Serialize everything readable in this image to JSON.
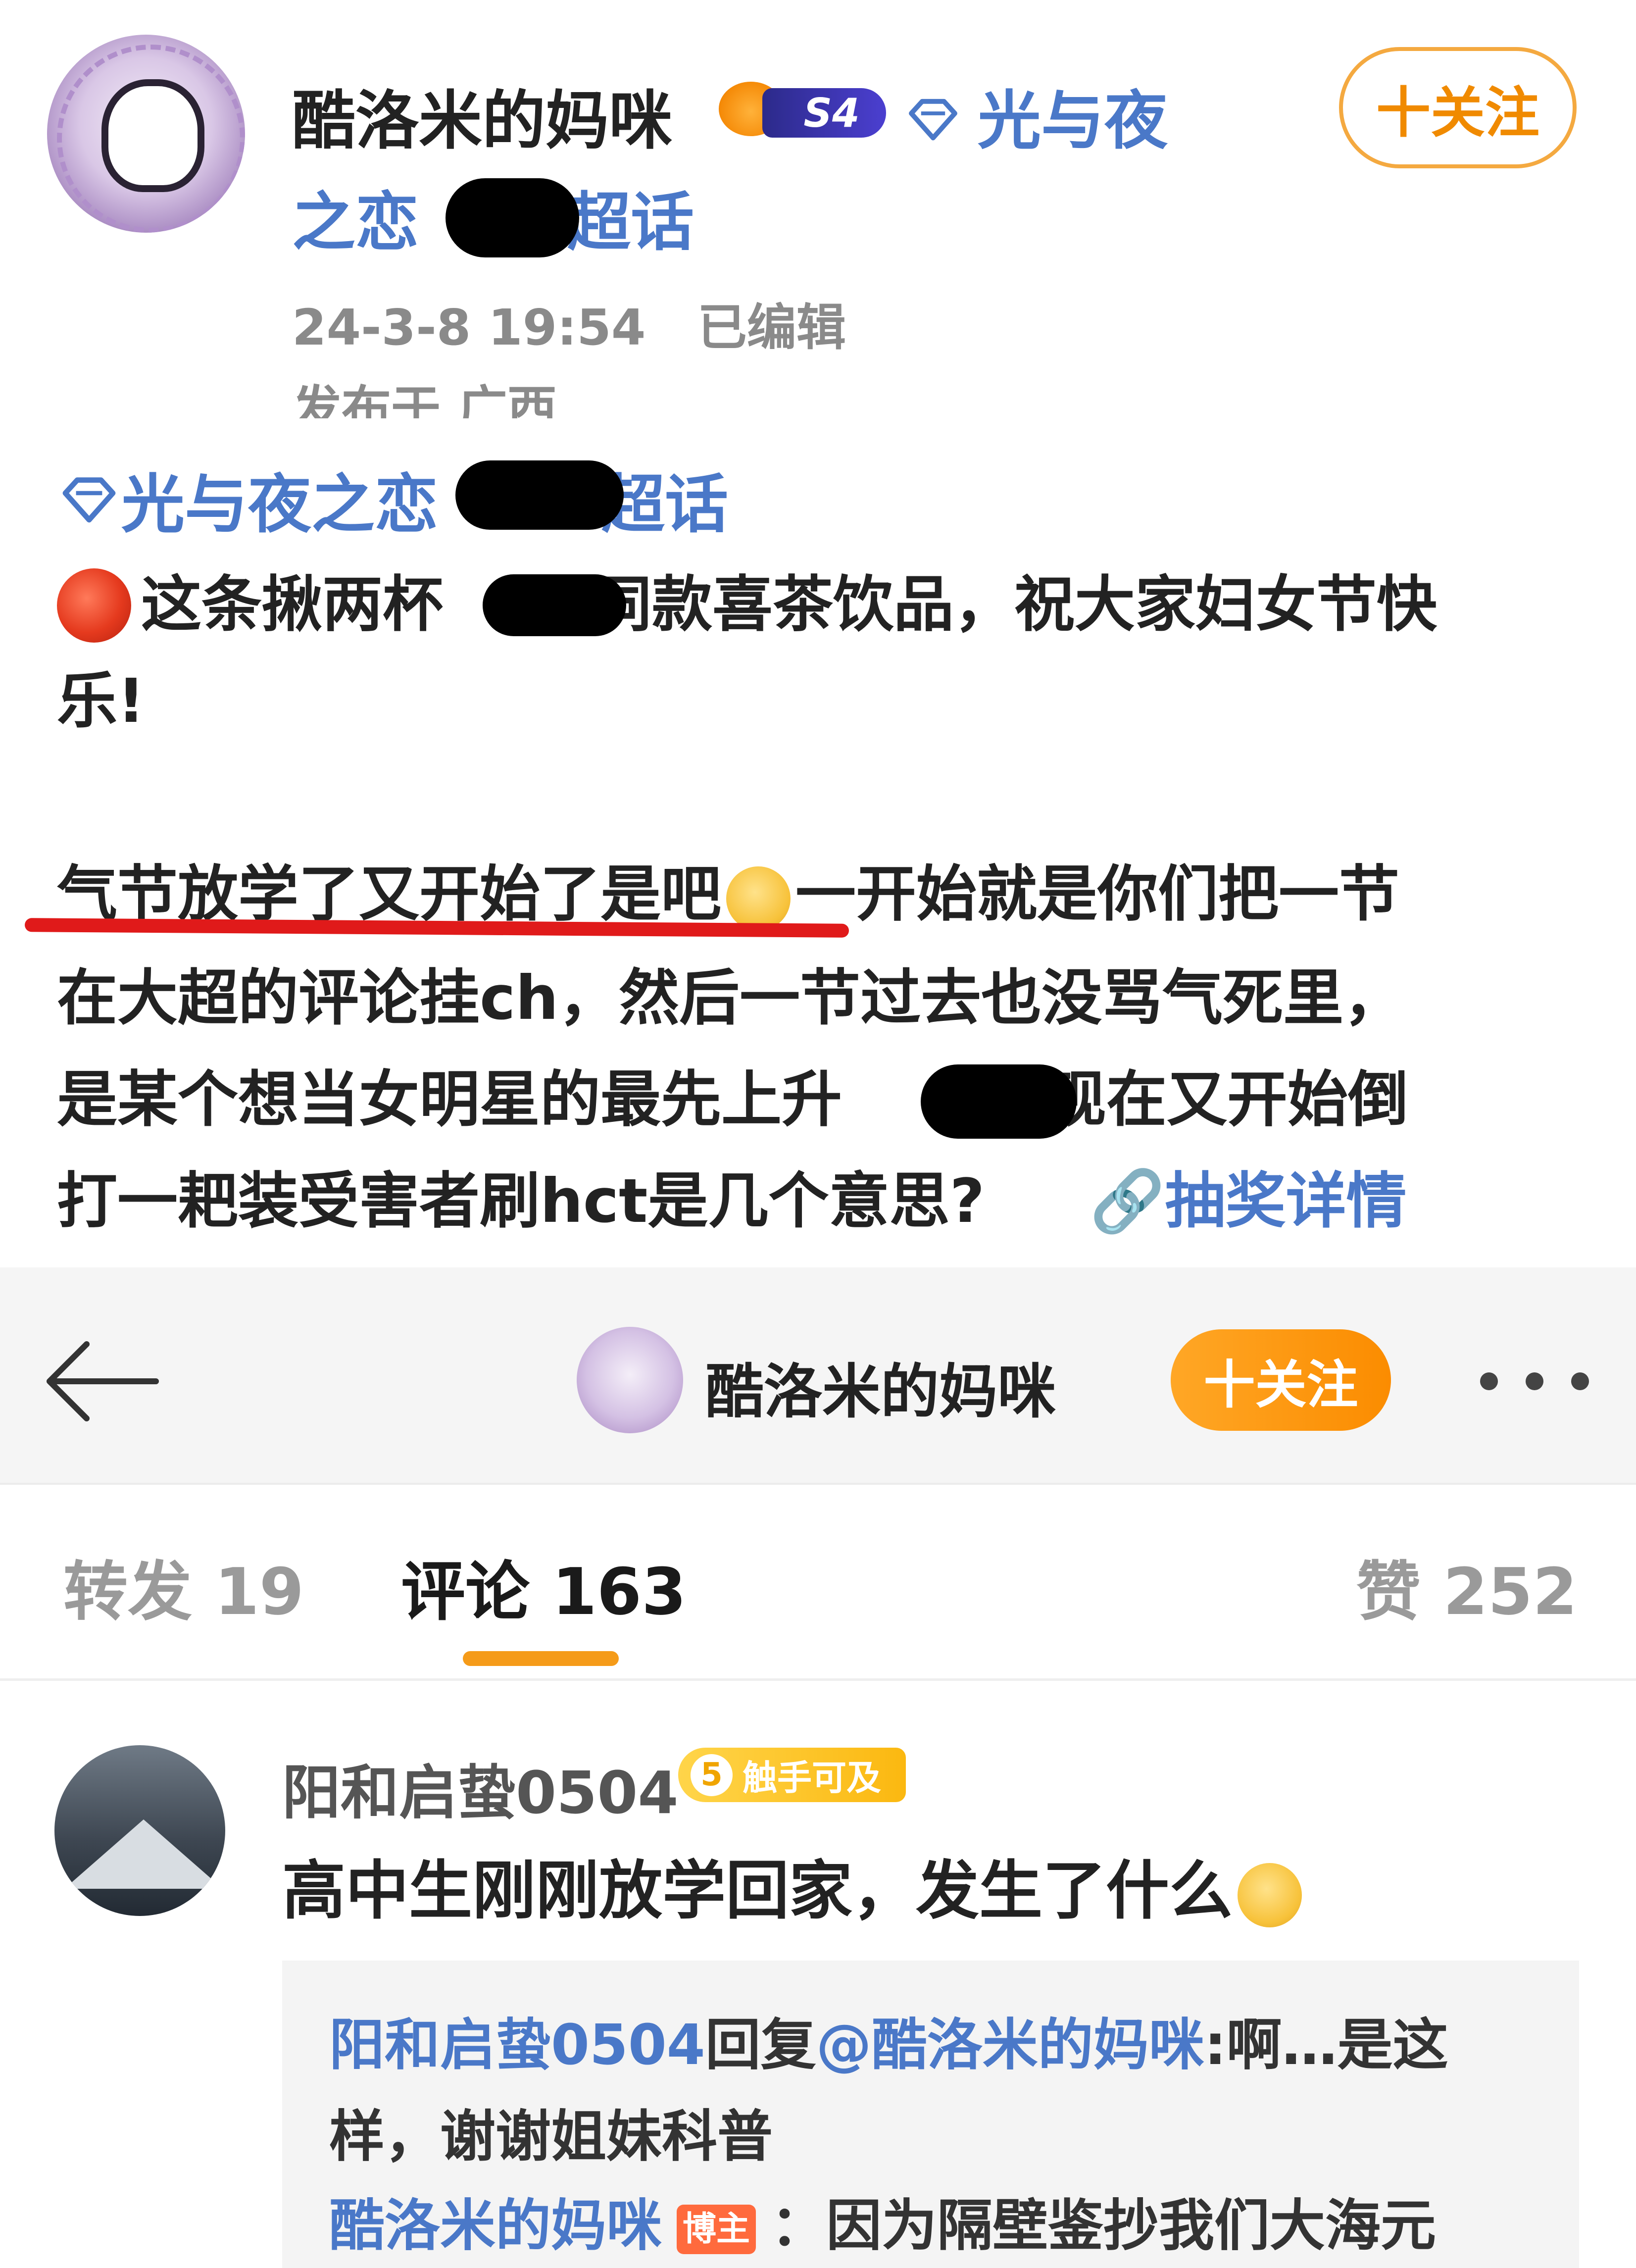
{
  "post": {
    "author_name": "酷洛米的妈咪",
    "level_badge": "S4",
    "topic_part1": "光与夜",
    "topic_part2_a": "之恋",
    "topic_part2_b": "超话",
    "follow_label": "十关注",
    "time": "24-3-8 19:54",
    "edited": "已编辑",
    "location": "发布于 广西",
    "topic_tag_a": "光与夜之恋",
    "topic_tag_b": "超话",
    "line1_a": "这条揪两杯",
    "line1_b": "同款喜茶饮品，祝大家妇女节快",
    "line2": "乐!",
    "line3_a": "气节放学了又开始了是吧",
    "line3_b": "一开始就是你们把一节",
    "line4": "在大超的评论挂ch，然后一节过去也没骂气死里，",
    "line5_a": "是某个想当女明星的最先上升",
    "line5_b": "，现在又开始倒",
    "line6": "打一耙装受害者刷hct是几个意思?",
    "lottery_link": "抽奖详情"
  },
  "nav": {
    "name": "酷洛米的妈咪",
    "follow_label": "十关注"
  },
  "tabs": {
    "repost": "转发 19",
    "comment": "评论 163",
    "like": "赞 252"
  },
  "comment": {
    "user": "阳和启蛰0504",
    "badge_level": "5",
    "badge_text": "触手可及",
    "text": "高中生刚刚放学回家，发生了什么",
    "reply1_user": "阳和启蛰0504",
    "reply1_verb": "回复",
    "reply1_mention": "@酷洛米的妈咪",
    "reply1_text_a": ":啊…是这",
    "reply1_text_b": "样，谢谢姐妹科普",
    "reply2_user": "酷洛米的妈咪",
    "reply2_badge": "博主",
    "reply2_text": "：因为隔壁鉴抄我们大海元"
  },
  "colors": {
    "link_blue": "#4a78c8",
    "follow_orange": "#fb8c00",
    "underline_red": "#e01a1a"
  }
}
